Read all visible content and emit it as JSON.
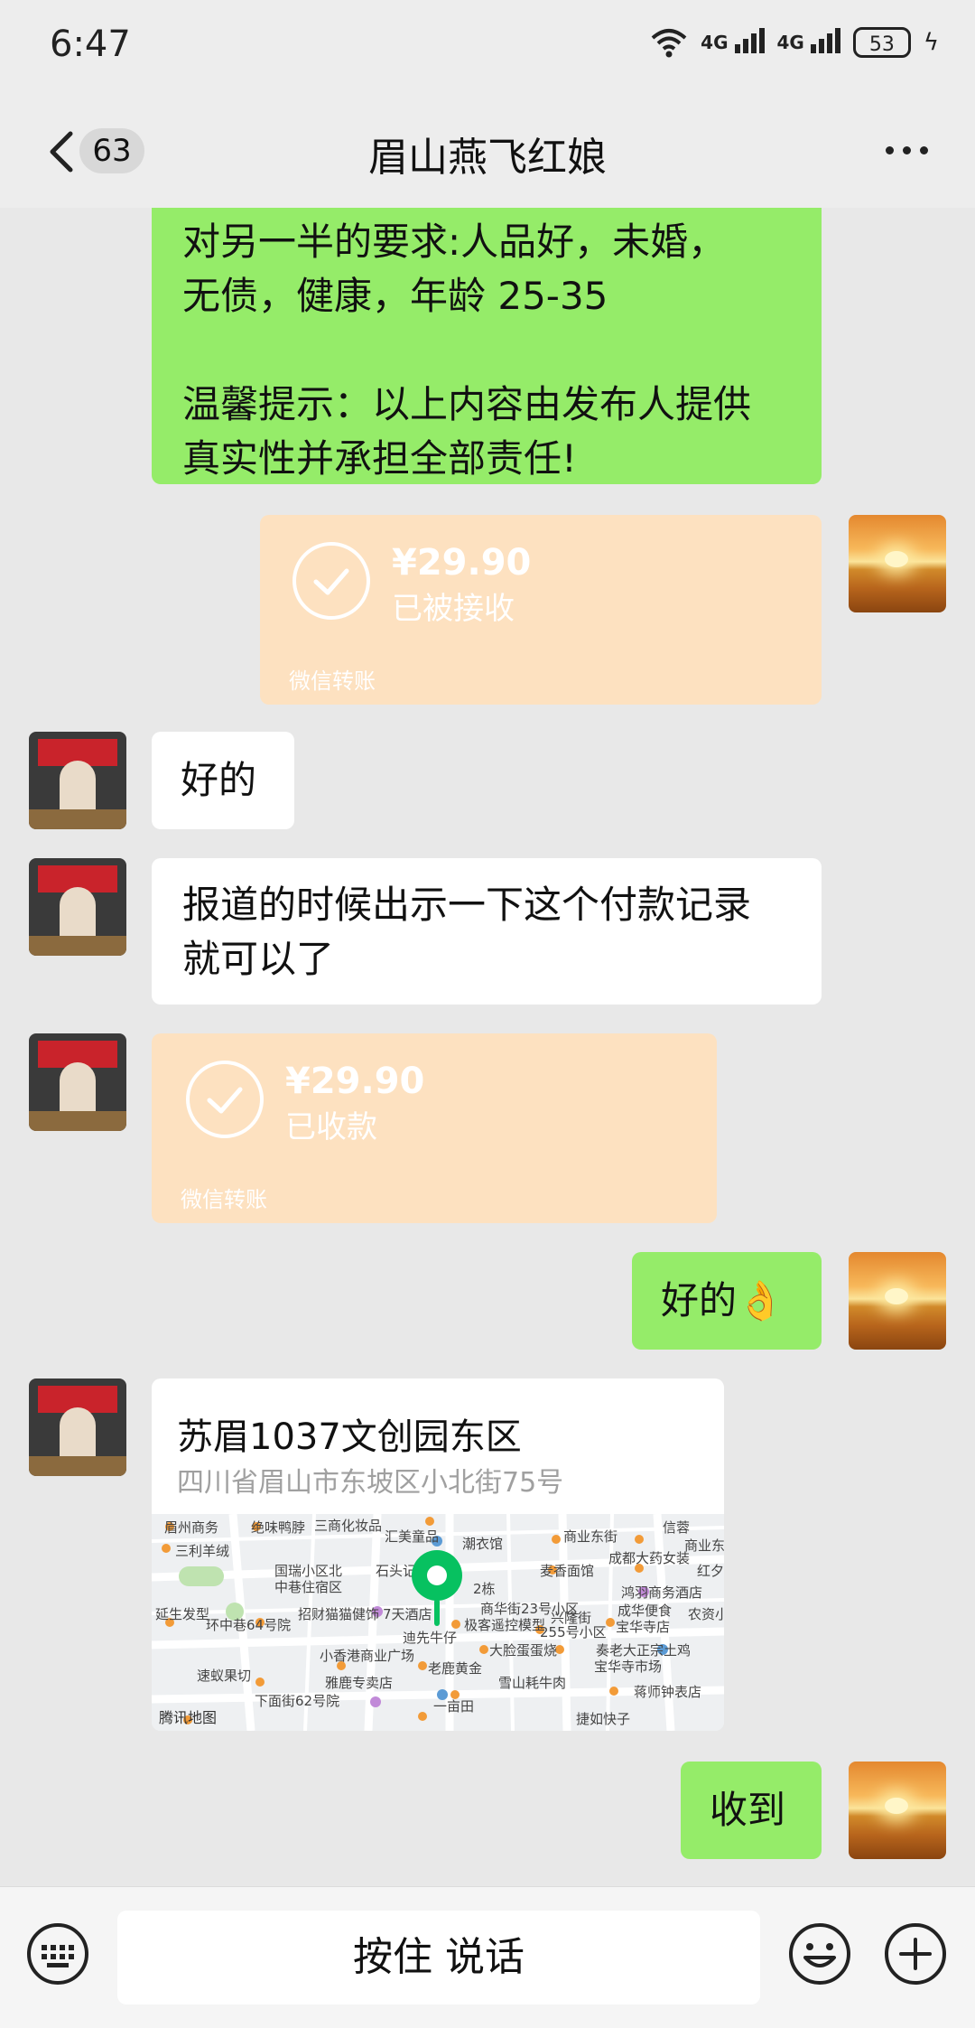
{
  "status_bar": {
    "time": "6:47",
    "network1": "4G",
    "network2": "4G",
    "battery": "53"
  },
  "header": {
    "unread_count": "63",
    "title": "眉山燕飞红娘"
  },
  "messages": {
    "m1": {
      "line1": "对另一半的要求:人品好，未婚，",
      "line2": "无债，健康，年龄 25-35",
      "line3": "温馨提示：以上内容由发布人提供",
      "line4": "真实性并承担全部责任!"
    },
    "transfer_sent": {
      "amount": "¥29.90",
      "status": "已被接收",
      "footer": "微信转账"
    },
    "m2": {
      "text": "好的"
    },
    "m3": {
      "line1": "报道的时候出示一下这个付款记录",
      "line2": "就可以了"
    },
    "transfer_received": {
      "amount": "¥29.90",
      "status": "已收款",
      "footer": "微信转账"
    },
    "m4": {
      "text": "好的👌"
    },
    "location": {
      "name": "苏眉1037文创园东区",
      "address": "四川省眉山市东坡区小北街75号",
      "map_provider": "腾讯地图",
      "map_labels": [
        "眉州商务",
        "绝味鸭脖",
        "三商化妆品",
        "汇美童品",
        "潮衣馆",
        "商业东街",
        "信蓉",
        "商业东",
        "三利羊绒",
        "国瑞小区北",
        "石头记",
        "麦香面馆",
        "成都大药女装",
        "红夕",
        "中巷住宿区",
        "2栋",
        "鸿羽商务酒店",
        "延生发型",
        "招财猫猫健饰",
        "7天酒店",
        "商华街23号小区",
        "兴隆街",
        "成华便食",
        "农资小",
        "环中巷64号院",
        "极客遥控模型",
        "255号小区",
        "宝华寺店",
        "迪先牛仔",
        "大脸蛋蛋烧",
        "奏老大正宗土鸡",
        "小香港商业广场",
        "老鹿黄金",
        "宝华寺市场",
        "雅鹿专卖店",
        "雪山耗牛肉",
        "蒋师钟表店",
        "速蚁果切",
        "下面街62号院",
        "一亩田",
        "捷如快子"
      ]
    },
    "m5": {
      "text": "收到"
    }
  },
  "input_bar": {
    "hold_to_talk": "按住 说话"
  },
  "icons": [
    "back-icon",
    "more-icon",
    "keyboard-icon",
    "emoji-icon",
    "plus-icon",
    "check-icon",
    "map-pin-icon"
  ],
  "colors": {
    "sent_bubble": "#95ec69",
    "received_bubble": "#ffffff",
    "transfer_bubble": "#fde1c0",
    "map_pin": "#07c160"
  }
}
